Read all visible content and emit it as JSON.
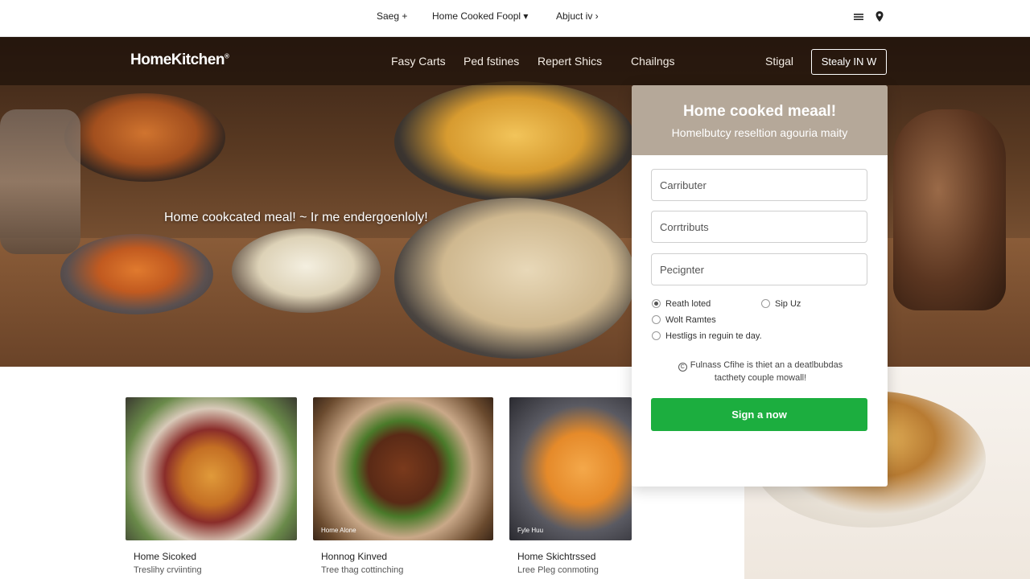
{
  "utility_bar": {
    "items": [
      "Saeg +",
      "Home Cooked Foopl ▾",
      "Abjuct iv ›"
    ],
    "icons": [
      "menu-lines-icon",
      "location-pin-icon"
    ]
  },
  "nav": {
    "logo": "HomeKitchen",
    "logo_mark": "®",
    "links": [
      "Fasy Carts",
      "Ped fstines",
      "Repert Shics",
      "Chailngs"
    ],
    "signin_text": "Stigal",
    "signup_button": "Stealy IN W"
  },
  "hero": {
    "tagline": "Home cookcated meal! ~ Ir me endergoenloly!"
  },
  "signup_panel": {
    "title": "Home cooked meaal!",
    "subtitle": "Homelbutcy reseltion agouria maity",
    "fields": [
      {
        "placeholder": "Carributer"
      },
      {
        "placeholder": "Corrtributs"
      },
      {
        "placeholder": "Pecignter"
      }
    ],
    "options": [
      {
        "label": "Reath loted",
        "selected": true
      },
      {
        "label": "Sip Uz",
        "selected": false
      },
      {
        "label": "Wolt Ramtes",
        "selected": false
      },
      {
        "label": "Hestligs in reguin te day.",
        "selected": false
      }
    ],
    "note_line1": "Fulnass Cfihe is thiet an a deatlbubdas",
    "note_line2": "tacthety couple mowall!",
    "cta": "Sign a now"
  },
  "cards": [
    {
      "title": "Home Sicoked",
      "subtitle": "Treslihy crviinting",
      "caption": ""
    },
    {
      "title": "Honnog Kinved",
      "subtitle": "Tree thag cottinching",
      "caption": "Home Alone"
    },
    {
      "title": "Home Skichtrssed",
      "subtitle": "Lree Pleg conmoting",
      "caption": "Fyle Huu"
    }
  ],
  "colors": {
    "cta_green": "#1cae3f",
    "nav_overlay": "#1e120a",
    "panel_header": "#786046"
  }
}
